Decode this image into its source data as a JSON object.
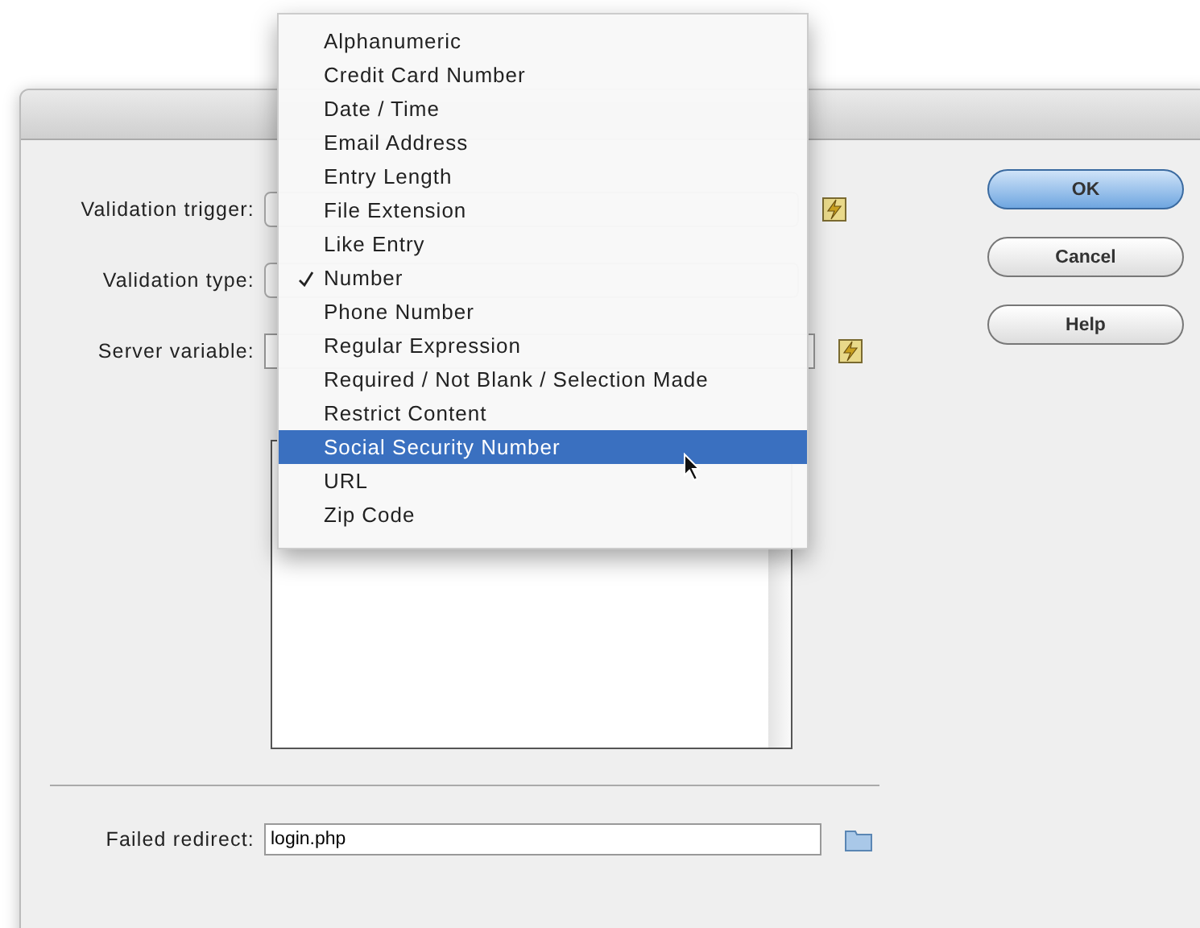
{
  "dialog": {
    "fields": [
      {
        "label": "Validation trigger:",
        "kind": "select",
        "icon": true
      },
      {
        "label": "Validation type:",
        "kind": "select",
        "icon": false
      },
      {
        "label": "Server variable:",
        "kind": "text",
        "icon": true
      }
    ],
    "failed_redirect": {
      "label": "Failed redirect:",
      "value": "login.php"
    },
    "buttons": [
      {
        "label": "OK",
        "default": true
      },
      {
        "label": "Cancel",
        "default": false
      },
      {
        "label": "Help",
        "default": false
      }
    ]
  },
  "menu": {
    "items": [
      {
        "label": "Alphanumeric",
        "checked": false,
        "selected": false
      },
      {
        "label": "Credit Card Number",
        "checked": false,
        "selected": false
      },
      {
        "label": "Date / Time",
        "checked": false,
        "selected": false
      },
      {
        "label": "Email Address",
        "checked": false,
        "selected": false
      },
      {
        "label": "Entry Length",
        "checked": false,
        "selected": false
      },
      {
        "label": "File Extension",
        "checked": false,
        "selected": false
      },
      {
        "label": "Like Entry",
        "checked": false,
        "selected": false
      },
      {
        "label": "Number",
        "checked": true,
        "selected": false
      },
      {
        "label": "Phone Number",
        "checked": false,
        "selected": false
      },
      {
        "label": "Regular Expression",
        "checked": false,
        "selected": false
      },
      {
        "label": "Required / Not Blank / Selection Made",
        "checked": false,
        "selected": false
      },
      {
        "label": "Restrict Content",
        "checked": false,
        "selected": false
      },
      {
        "label": "Social Security Number",
        "checked": false,
        "selected": true
      },
      {
        "label": "URL",
        "checked": false,
        "selected": false
      },
      {
        "label": "Zip Code",
        "checked": false,
        "selected": false
      }
    ]
  }
}
